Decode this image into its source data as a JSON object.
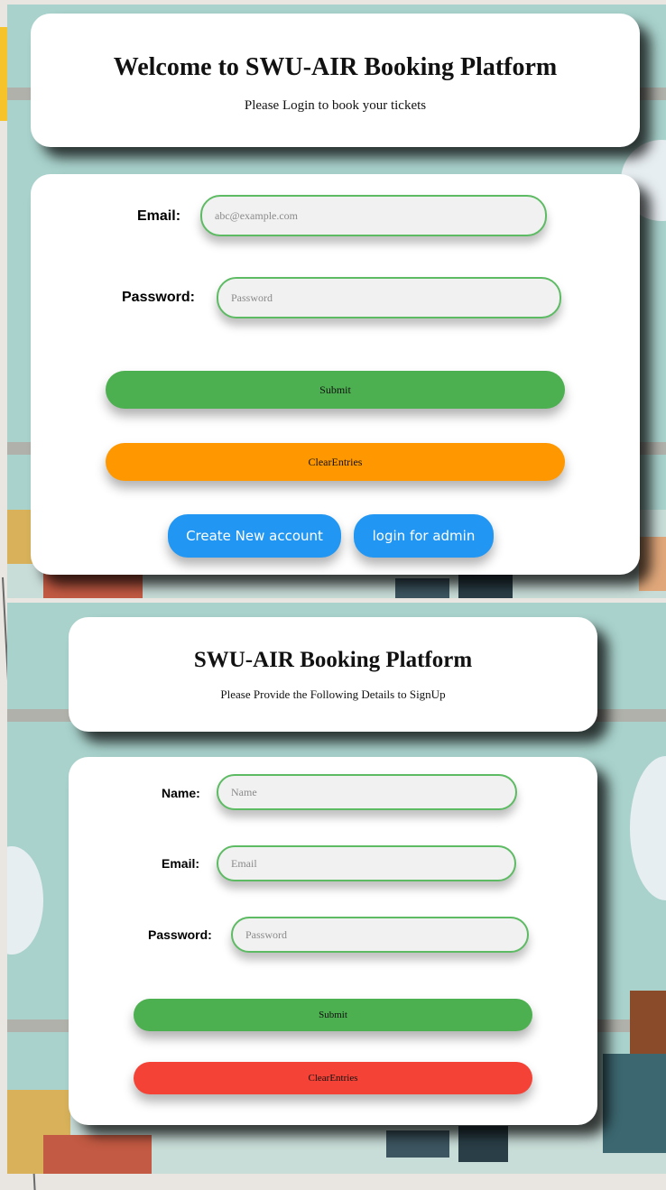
{
  "colors": {
    "submit": "#4caf50",
    "clear_login": "#ff9800",
    "clear_signup": "#f44336",
    "secondary": "#2196f3",
    "input_border": "#5dbb63"
  },
  "login": {
    "title": "Welcome to SWU-AIR Booking Platform",
    "subtitle": "Please Login to book your tickets",
    "email_label": "Email:",
    "email_placeholder": "abc@example.com",
    "password_label": "Password:",
    "password_placeholder": "Password",
    "submit_label": "Submit",
    "clear_label": "ClearEntries",
    "create_account_label": "Create New account",
    "admin_login_label": "login for admin"
  },
  "signup": {
    "title": "SWU-AIR Booking Platform",
    "subtitle": "Please Provide the Following Details to SignUp",
    "name_label": "Name:",
    "name_placeholder": "Name",
    "email_label": "Email:",
    "email_placeholder": "Email",
    "password_label": "Password:",
    "password_placeholder": "Password",
    "submit_label": "Submit",
    "clear_label": "ClearEntries"
  }
}
